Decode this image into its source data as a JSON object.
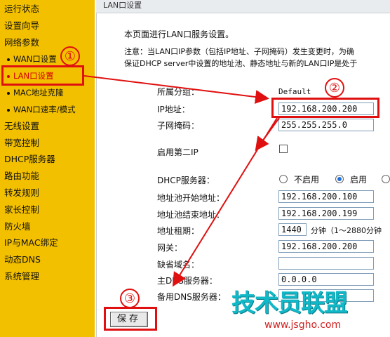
{
  "sidebar": {
    "items": [
      {
        "label": "运行状态"
      },
      {
        "label": "设置向导"
      },
      {
        "label": "网络参数"
      },
      {
        "label": "WAN口设置"
      },
      {
        "label": "LAN口设置"
      },
      {
        "label": "MAC地址克隆"
      },
      {
        "label": "WAN口速率/模式"
      },
      {
        "label": "无线设置"
      },
      {
        "label": "带宽控制"
      },
      {
        "label": "DHCP服务器"
      },
      {
        "label": "路由功能"
      },
      {
        "label": "转发规则"
      },
      {
        "label": "家长控制"
      },
      {
        "label": "防火墙"
      },
      {
        "label": "IP与MAC绑定"
      },
      {
        "label": "动态DNS"
      },
      {
        "label": "系统管理"
      }
    ]
  },
  "panel": {
    "title": "LAN口设置",
    "intro": "本页面进行LAN口服务设置。",
    "note_line1": "注意：当LAN口IP参数（包括IP地址、子网掩码）发生变更时，为确",
    "note_line2": "保证DHCP server中设置的地址池、静态地址与新的LAN口IP是处于"
  },
  "form": {
    "group_label": "所属分组：",
    "group_value": "Default",
    "ip_label": "IP地址：",
    "ip_value": "192.168.200.200",
    "mask_label": "子网掩码：",
    "mask_value": "255.255.255.0",
    "second_ip_label": "启用第二IP",
    "dhcp_label": "DHCP服务器：",
    "dhcp_off": "不启用",
    "dhcp_on": "启用",
    "pool_start_label": "地址池开始地址：",
    "pool_start_value": "192.168.200.100",
    "pool_end_label": "地址池结束地址：",
    "pool_end_value": "192.168.200.199",
    "lease_label": "地址租期：",
    "lease_value": "1440",
    "lease_unit": "分钟（1～2880分钟",
    "gateway_label": "网关：",
    "gateway_value": "192.168.200.200",
    "domain_label": "缺省域名：",
    "domain_value": "",
    "dns1_label": "主DNS服务器：",
    "dns1_value": "0.0.0.0",
    "dns2_label": "备用DNS服务器：",
    "dns2_value": ""
  },
  "buttons": {
    "save": "保存"
  },
  "annotations": {
    "step1": "①",
    "step2": "②",
    "step3": "③"
  },
  "watermark": {
    "brand": "技术员联盟",
    "url": "www.jsgho.com"
  },
  "colors": {
    "sidebar_bg": "#f3c000",
    "annotation_red": "#e01010",
    "watermark_cyan": "#11b8c8"
  }
}
